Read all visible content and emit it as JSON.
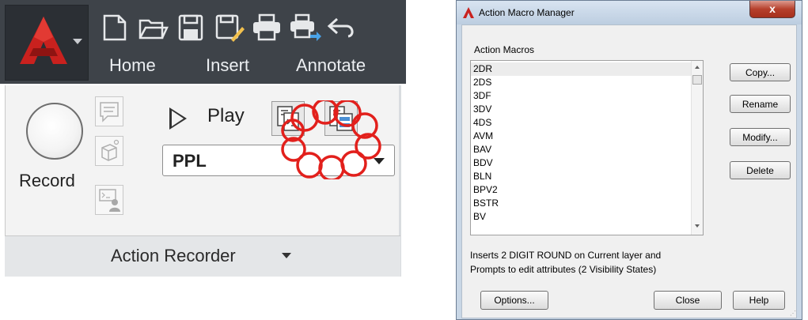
{
  "ribbon": {
    "tabs": [
      {
        "label": "Home"
      },
      {
        "label": "Insert"
      },
      {
        "label": "Annotate"
      }
    ],
    "quick_access_icons": [
      "new-icon",
      "open-icon",
      "save-icon",
      "save-as-icon",
      "plot-icon",
      "publish-icon",
      "undo-icon"
    ],
    "record_label": "Record",
    "play_label": "Play",
    "macro_select_value": "PPL",
    "panel_title": "Action Recorder",
    "colors": {
      "app_red": "#c9211e",
      "ribbon_dark": "#3e4349",
      "highlight_cloud": "#e2201c"
    }
  },
  "dialog": {
    "title": "Action Macro Manager",
    "close_glyph": "x",
    "list_caption": "Action Macros",
    "macros": [
      "2DR",
      "2DS",
      "3DF",
      "3DV",
      "4DS",
      "AVM",
      "BAV",
      "BDV",
      "BLN",
      "BPV2",
      "BSTR",
      "BV"
    ],
    "selected_index": 0,
    "side_buttons": {
      "copy": "Copy...",
      "rename": "Rename",
      "modify": "Modify...",
      "delete": "Delete"
    },
    "description_line1": "Inserts 2 DIGIT ROUND on Current layer and",
    "description_line2": "Prompts to edit attributes (2 Visibility States)",
    "bottom_buttons": {
      "options": "Options...",
      "close": "Close",
      "help": "Help"
    }
  }
}
